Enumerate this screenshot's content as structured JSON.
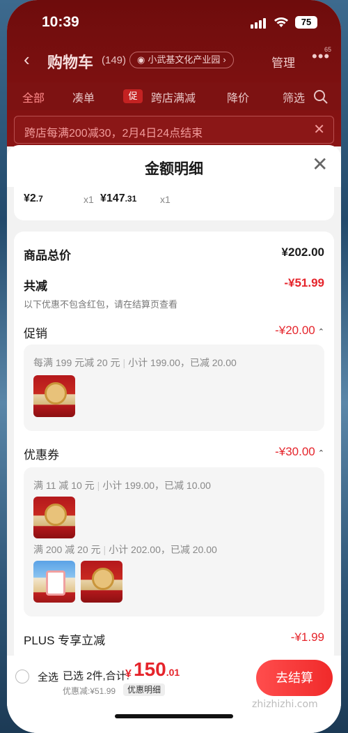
{
  "status_bar": {
    "time": "10:39",
    "battery": "75"
  },
  "header": {
    "title": "购物车",
    "count": "(149)",
    "address": "小武基文化产业园",
    "manage": "管理",
    "more": "•••",
    "badge": "65"
  },
  "tabs": [
    "全部",
    "凑单",
    "促",
    "跨店满减",
    "降价",
    "筛选"
  ],
  "promo_banner": "跨店每满200减30，2月4日24点结束",
  "sheet": {
    "title": "金额明细",
    "items": [
      {
        "price_main": "¥2",
        "price_dec": ".7",
        "qty": "x1"
      },
      {
        "price_main": "¥147",
        "price_dec": ".31",
        "qty": "x1"
      }
    ],
    "total_label": "商品总价",
    "total_value": "¥202.00",
    "reduce_label": "共减",
    "reduce_value": "-¥51.99",
    "reduce_note": "以下优惠不包含红包，请在结算页查看",
    "promo": {
      "label": "促销",
      "value": "-¥20.00",
      "rule": "每满 199 元减 20 元",
      "subtotal": "小计 199.00，已减 20.00"
    },
    "coupon": {
      "label": "优惠券",
      "value": "-¥30.00",
      "rule1": "满 11 减 10 元",
      "subtotal1": "小计 199.00，已减 10.00",
      "rule2": "满 200 减 20 元",
      "subtotal2": "小计 202.00，已减 20.00"
    },
    "plus": {
      "label": "PLUS 专享立减",
      "value": "-¥1.99"
    }
  },
  "bottom_bar": {
    "select_all": "全选",
    "selected": "已选 2件,合计:",
    "currency": "¥",
    "price_main": "150",
    "price_dec": ".01",
    "discount": "优惠减:¥51.99",
    "detail_button": "优惠明细",
    "checkout": "去结算"
  },
  "watermark": "zhizhizhi.com",
  "colors": {
    "accent_red": "#e5242b",
    "header_bg": "#7b1010"
  }
}
